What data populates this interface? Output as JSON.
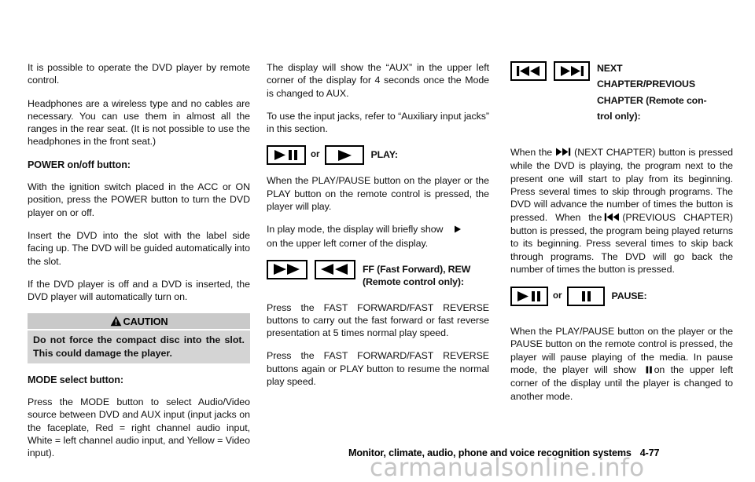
{
  "document": {
    "footer_title": "Monitor, climate, audio, phone and voice recognition systems",
    "page_number": "4-77",
    "watermark": "carmanualsonline.info"
  },
  "left_column": {
    "para_1": "It is possible to operate the DVD player by remote control.",
    "para_2": "Headphones are a wireless type and no cables are necessary. You can use them in almost all the ranges in the rear seat. (It is not possible to use the headphones in the front seat.)",
    "heading_power": "POWER on/off button:",
    "para_3": "With the ignition switch placed in the ACC or ON position, press the POWER button to turn the DVD player on or off.",
    "para_4": "Insert the DVD into the slot with the label side facing up. The DVD will be guided automatically into the slot.",
    "para_5": "If the DVD player is off and a DVD is inserted, the DVD player will automatically turn on.",
    "caution": {
      "header": "CAUTION",
      "body": "Do not force the compact disc into the slot. This could damage the player."
    },
    "heading_mode": "MODE select button:",
    "para_6": "Press the MODE button to select Audio/Video source between DVD and AUX input (input jacks on the faceplate, Red = right channel audio input, White = left channel audio input, and Yellow = Video input)."
  },
  "mid_column": {
    "para_1": "The display will show the “AUX” in the upper left corner of the display for 4 seconds once the Mode is changed to AUX.",
    "para_2": "To use the input jacks, refer to “Auxiliary input jacks” in this section.",
    "play_row": {
      "icon_1": "play-pause-icon",
      "or_label": "or",
      "icon_2": "play-icon",
      "caption": "PLAY:"
    },
    "para_3": "When the PLAY/PAUSE button on the player or the PLAY button on the remote control is pressed, the player will play.",
    "para_4_a": "In play mode, the display will briefly show",
    "para_4_inline_icon": "play-icon",
    "para_4_b": "on the upper left corner of the display.",
    "ff_row": {
      "icon_1": "fast-forward-icon",
      "icon_2": "rewind-icon",
      "caption_line1": "FF (Fast Forward), REW",
      "caption_line2": "(Remote control only):"
    },
    "para_5": "Press the FAST FORWARD/FAST REVERSE buttons to carry out the fast forward or fast reverse presentation at 5 times normal play speed.",
    "para_6": "Press the FAST FORWARD/FAST REVERSE buttons again or PLAY button to resume the normal play speed."
  },
  "right_column": {
    "chapter_row": {
      "icon_1": "previous-chapter-icon",
      "icon_2": "next-chapter-icon",
      "caption_line1": "NEXT",
      "caption_line2": "CHAPTER/PREVIOUS",
      "caption_line3": "CHAPTER (Remote con-",
      "caption_line4": "trol only):"
    },
    "para_1_a": "When the",
    "para_1_icon_next": "next-chapter-icon",
    "para_1_b": "(NEXT CHAPTER) button is pressed while the DVD is playing, the program next to the present one will start to play from its beginning. Press several times to skip through programs. The DVD will advance the number of times the button is pressed. When the",
    "para_1_icon_prev": "previous-chapter-icon",
    "para_1_c": "(PREVIOUS CHAPTER) button is pressed, the program being played returns to its beginning. Press several times to skip back through programs. The DVD will go back the number of times the button is pressed.",
    "pause_row": {
      "icon_1": "play-pause-icon",
      "or_label": "or",
      "icon_2": "pause-icon",
      "caption": "PAUSE:"
    },
    "para_2_a": "When the PLAY/PAUSE button on the player or the PAUSE button on the remote control is pressed, the player will pause playing of the media. In pause mode, the player will show",
    "para_2_icon": "pause-icon",
    "para_2_b": "on the upper left corner of the display until the player is changed to another mode."
  },
  "colors": {
    "text": "#111111",
    "caution_header_bg": "#c9c9c9",
    "caution_body_bg": "#d4d4d4",
    "watermark": "#c6c6c6",
    "page_bg": "#ffffff"
  }
}
